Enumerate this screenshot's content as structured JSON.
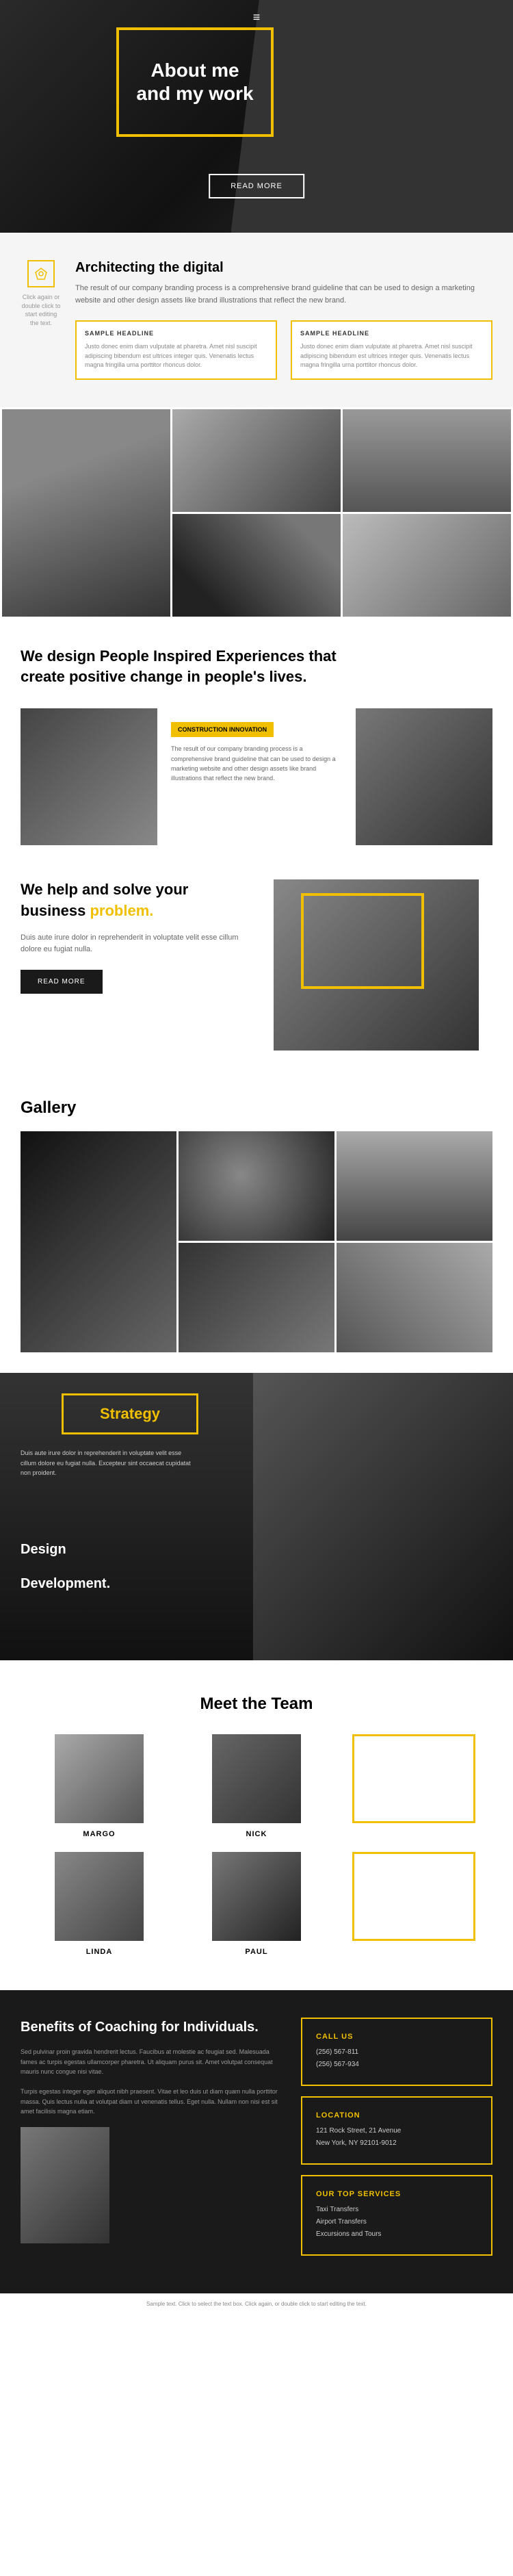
{
  "hero": {
    "hamburger": "≡",
    "title": "About me\nand my work",
    "read_more": "READ MORE"
  },
  "arch": {
    "title": "Architecting the digital",
    "desc": "The result of our company branding process is a comprehensive brand guideline that can be used to design a marketing website and other design assets like brand illustrations that reflect the new brand.",
    "click_text": "Click again or double click to start editing the text.",
    "sample1": {
      "headline": "SAMPLE HEADLINE",
      "text": "Justo donec enim diam vulputate at pharetra. Amet nisl suscipit adipiscing bibendum est ultrices integer quis. Venenatis lectus magna fringilla urna porttitor rhoncus dolor."
    },
    "sample2": {
      "headline": "SAMPLE HEADLINE",
      "text": "Justo donec enim diam vulputate at pharetra. Amet nisl suscipit adipiscing bibendum est ultrices integer quis. Venenatis lectus magna fringilla urna porttitor rhoncus dolor."
    }
  },
  "design_section": {
    "title": "We design People Inspired Experiences that\ncreate positive change in people's lives.",
    "badge": "CONSTRUCTION INNOVATION",
    "desc": "The result of our company branding process is a comprehensive brand guideline that can be used to design a marketing website and other design assets like brand illustrations that reflect the new brand."
  },
  "business": {
    "title": "We help and solve your\nbusiness",
    "highlight": "problem.",
    "desc": "Duis aute irure dolor in reprehenderit in voluptate velit esse cillum dolore eu fugiat nulla.",
    "read_more": "READ MORE"
  },
  "gallery": {
    "title": "Gallery"
  },
  "strategy": {
    "label": "Strategy",
    "text": "Duis aute irure dolor in reprehenderit in voluptate velit esse cillum dolore eu fugiat nulla. Excepteur sint occaecat cupidatat non proident.",
    "design": "Design",
    "development": "Development."
  },
  "team": {
    "title": "Meet the Team",
    "members": [
      {
        "name": "MARGO",
        "has_photo": true
      },
      {
        "name": "NICK",
        "has_photo": true
      },
      {
        "name": "",
        "has_photo": false
      },
      {
        "name": "LINDA",
        "has_photo": true
      },
      {
        "name": "PAUL",
        "has_photo": true
      },
      {
        "name": "",
        "has_photo": false
      }
    ]
  },
  "contact": {
    "title": "Benefits of\nCoaching for\nIndividuals.",
    "desc1": "Sed pulvinar proin gravida hendrerit lectus. Faucibus at molestie ac feugiat sed. Malesuada fames ac turpis egestas ullamcorper pharetra. Ut aliquam purus sit. Amet volutpat consequat mauris nunc congue nisi vitae.",
    "desc2": "Turpis egestas integer eger aliquot nibh praesent. Vitae et leo duis ut diam quam nulla porttitor massa. Quis lectus nulla at volutpat diam ut venenatis tellus. Eget nulla. Nullam non nisi est sit amet facilisis magna etiam.",
    "call_us": {
      "label": "CALL US",
      "phone1": "(256) 567-811",
      "phone2": "(256) 567-934"
    },
    "location": {
      "label": "LOCATION",
      "address1": "121 Rock Street, 21 Avenue",
      "address2": "New York, NY 92101-9012"
    },
    "services": {
      "label": "OUR TOP SERVICES",
      "items": [
        "Taxi Transfers",
        "Airport Transfers",
        "Excursions and Tours"
      ]
    }
  },
  "footer": {
    "text": "Sample text. Click to select the text box. Click again, or double click to start editing the text."
  }
}
